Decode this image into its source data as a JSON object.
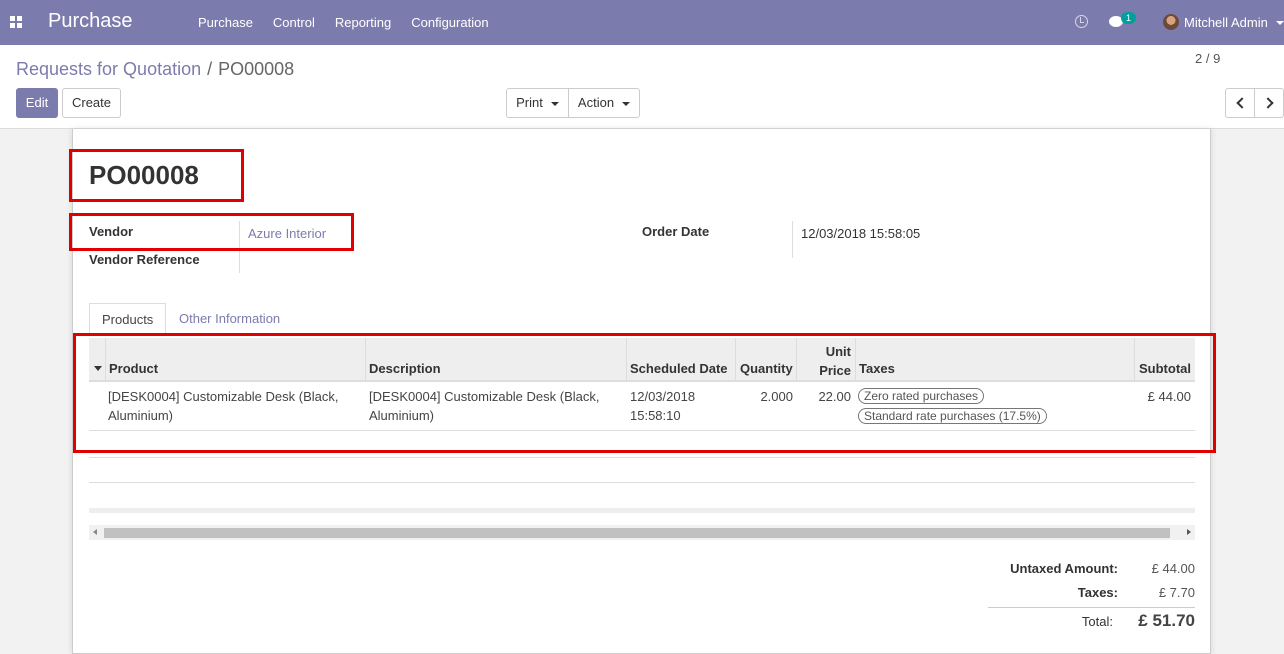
{
  "navbar": {
    "app_title": "Purchase",
    "menu": [
      "Purchase",
      "Control",
      "Reporting",
      "Configuration"
    ],
    "chat_badge": "1",
    "user_name": "Mitchell Admin",
    "icons": [
      "apps-grid-icon",
      "clock-icon",
      "chat-icon",
      "avatar",
      "chevron-down-icon"
    ]
  },
  "breadcrumb": {
    "parent": "Requests for Quotation",
    "separator": "/",
    "current": "PO00008"
  },
  "toolbar": {
    "edit_label": "Edit",
    "create_label": "Create",
    "print_label": "Print",
    "action_label": "Action",
    "pager": "2 / 9"
  },
  "form": {
    "title": "PO00008",
    "vendor_label": "Vendor",
    "vendor_value": "Azure Interior",
    "vendor_ref_label": "Vendor Reference",
    "vendor_ref_value": "",
    "order_date_label": "Order Date",
    "order_date_value": "12/03/2018 15:58:05"
  },
  "tabs": [
    "Products",
    "Other Information"
  ],
  "table": {
    "headers": {
      "product": "Product",
      "description": "Description",
      "scheduled_date": "Scheduled Date",
      "quantity": "Quantity",
      "unit_price_1": "Unit",
      "unit_price_2": "Price",
      "taxes": "Taxes",
      "subtotal": "Subtotal"
    },
    "rows": [
      {
        "product_1": "[DESK0004] Customizable Desk (Black,",
        "product_2": "Aluminium)",
        "description_1": "[DESK0004] Customizable Desk (Black,",
        "description_2": "Aluminium)",
        "date_1": "12/03/2018",
        "date_2": "15:58:10",
        "quantity": "2.000",
        "unit_price": "22.00",
        "taxes": [
          "Zero rated purchases",
          "Standard rate purchases (17.5%)"
        ],
        "subtotal": "£ 44.00"
      }
    ]
  },
  "totals": {
    "untaxed_label": "Untaxed Amount:",
    "untaxed_value": "£ 44.00",
    "taxes_label": "Taxes:",
    "taxes_value": "£ 7.70",
    "total_label": "Total:",
    "total_value": "£ 51.70"
  },
  "colors": {
    "brand": "#7c7bad",
    "highlight": "#e00000",
    "badge": "#00a09d"
  }
}
